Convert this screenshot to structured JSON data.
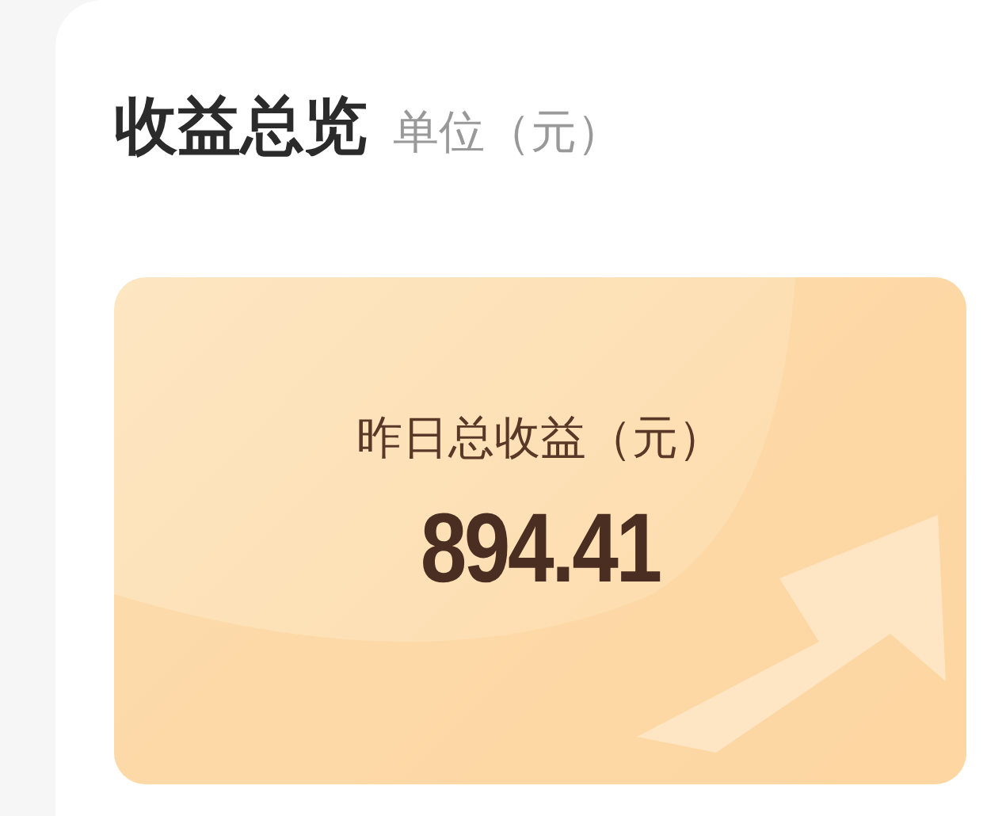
{
  "header": {
    "title": "收益总览",
    "unit": "单位（元）"
  },
  "summary": {
    "label": "昨日总收益（元）",
    "value": "894.41"
  }
}
